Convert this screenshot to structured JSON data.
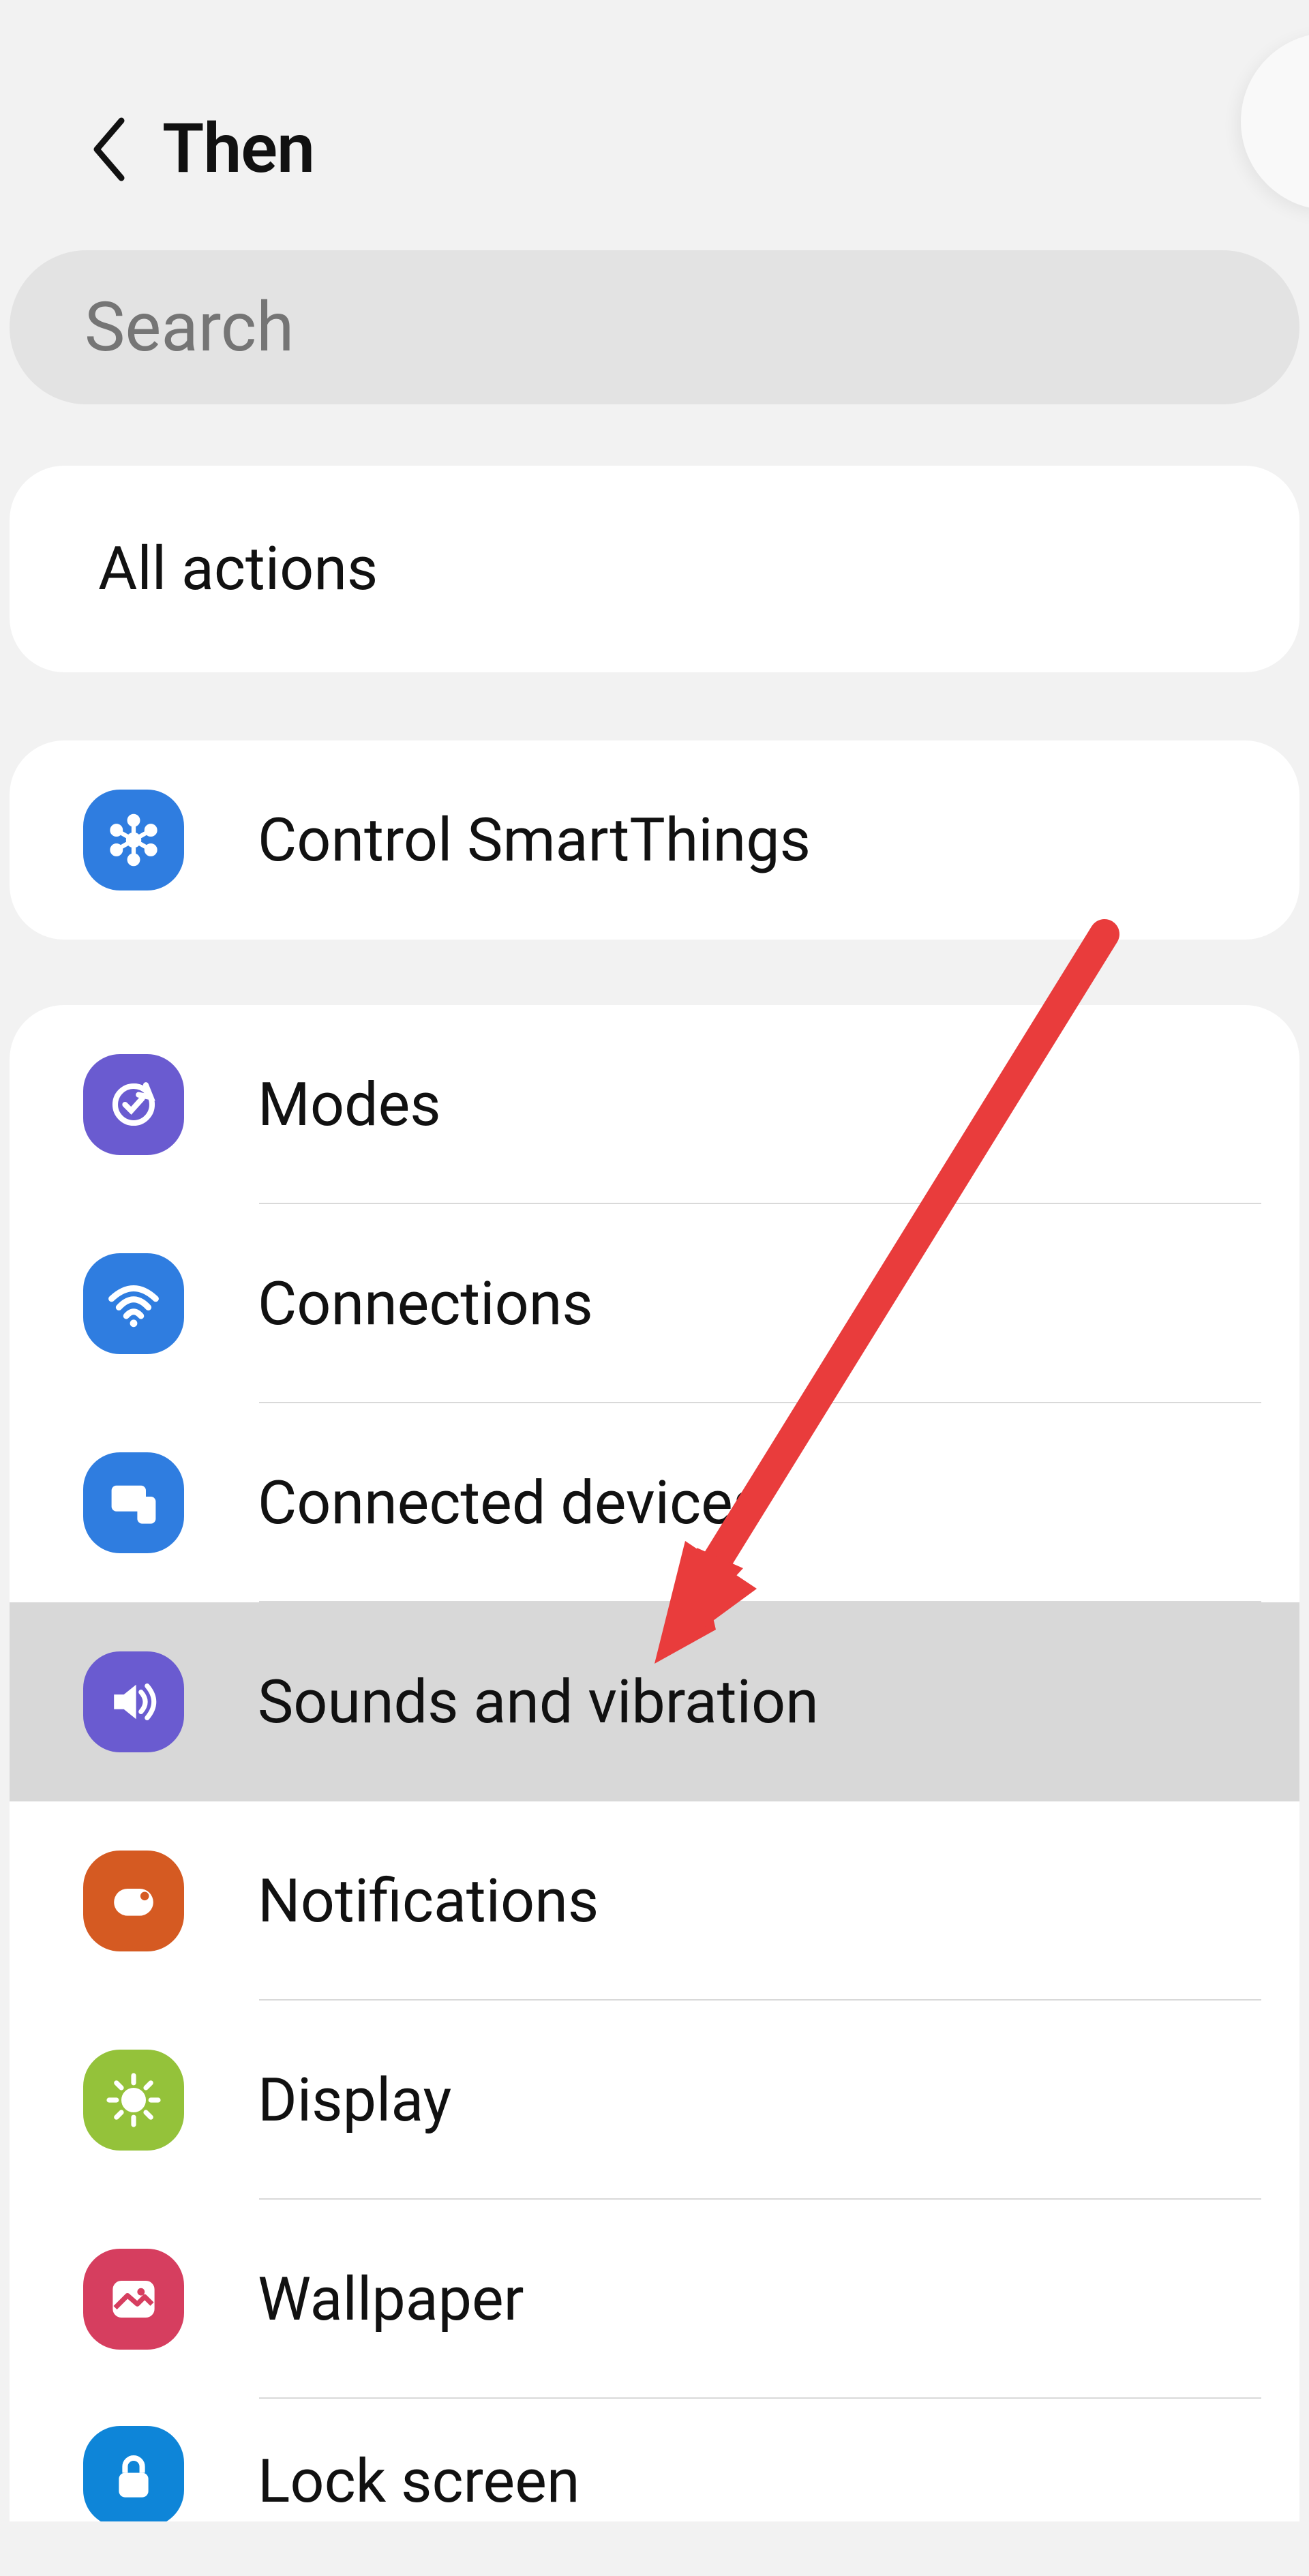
{
  "header": {
    "title": "Then"
  },
  "search": {
    "placeholder": "Search",
    "value": ""
  },
  "allActions": {
    "label": "All actions"
  },
  "smartThings": {
    "label": "Control SmartThings",
    "icon": "smartthings-icon",
    "color": "#2f7de0"
  },
  "settingsList": [
    {
      "id": "modes",
      "label": "Modes",
      "icon": "modes-icon",
      "color": "#6a5bd0",
      "highlighted": false
    },
    {
      "id": "connections",
      "label": "Connections",
      "icon": "wifi-icon",
      "color": "#2f7de0",
      "highlighted": false
    },
    {
      "id": "connected",
      "label": "Connected devices",
      "icon": "devices-icon",
      "color": "#2f7de0",
      "highlighted": false
    },
    {
      "id": "sounds",
      "label": "Sounds and vibration",
      "icon": "volume-icon",
      "color": "#6a5bd0",
      "highlighted": true
    },
    {
      "id": "notif",
      "label": "Notifications",
      "icon": "notification-icon",
      "color": "#d55a22",
      "highlighted": false
    },
    {
      "id": "display",
      "label": "Display",
      "icon": "sun-icon",
      "color": "#94c23a",
      "highlighted": false
    },
    {
      "id": "wallpaper",
      "label": "Wallpaper",
      "icon": "picture-icon",
      "color": "#d63e5f",
      "highlighted": false
    },
    {
      "id": "lock",
      "label": "Lock screen",
      "icon": "lock-icon",
      "color": "#0e85d8",
      "highlighted": false
    }
  ],
  "annotation": {
    "arrow_color": "#e93c3c",
    "target_row_id": "sounds"
  }
}
